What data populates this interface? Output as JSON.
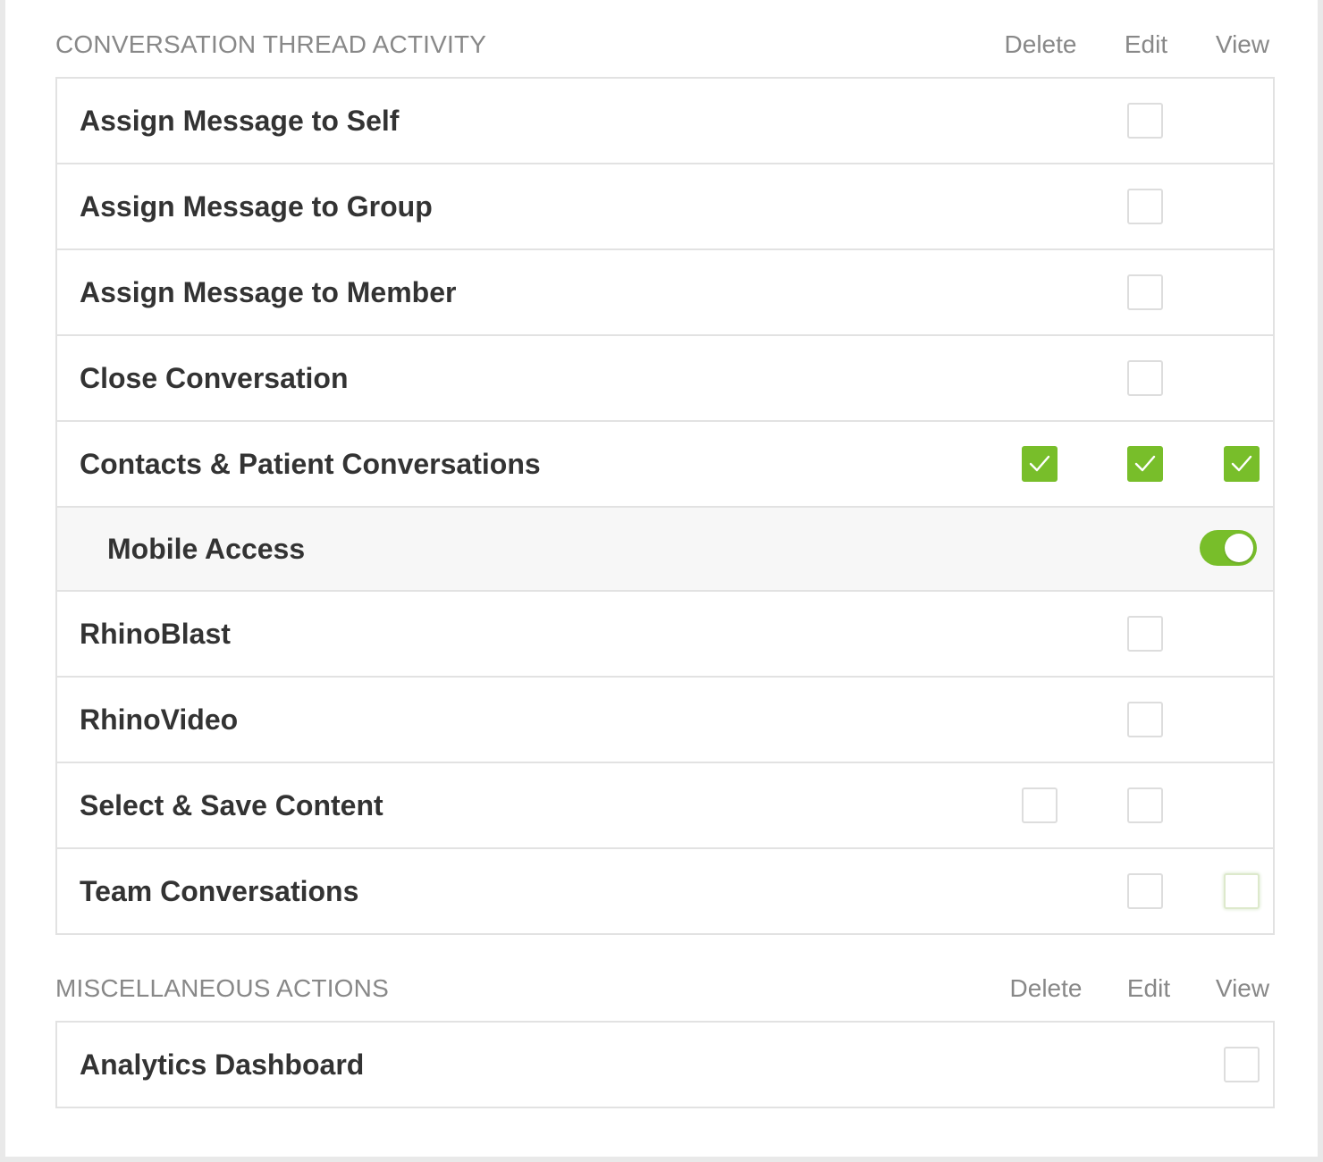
{
  "sections": [
    {
      "title": "CONVERSATION THREAD ACTIVITY",
      "columns": {
        "delete": "Delete",
        "edit": "Edit",
        "view": "View"
      },
      "rows": [
        {
          "label": "Assign Message to Self",
          "edit": false
        },
        {
          "label": "Assign Message to Group",
          "edit": false
        },
        {
          "label": "Assign Message to Member",
          "edit": false
        },
        {
          "label": "Close Conversation",
          "edit": false
        },
        {
          "label": "Contacts & Patient Conversations",
          "delete": true,
          "edit": true,
          "view": true
        },
        {
          "label": "Mobile Access",
          "toggle": true,
          "sub": true
        },
        {
          "label": "RhinoBlast",
          "edit": false
        },
        {
          "label": "RhinoVideo",
          "edit": false
        },
        {
          "label": "Select & Save Content",
          "delete": false,
          "edit": false
        },
        {
          "label": "Team Conversations",
          "edit": false,
          "view": false
        }
      ]
    },
    {
      "title": "MISCELLANEOUS ACTIONS",
      "columns": {
        "delete": "Delete",
        "edit": "Edit",
        "view": "View"
      },
      "rows": [
        {
          "label": "Analytics Dashboard",
          "view": false
        }
      ]
    }
  ],
  "colors": {
    "accent": "#78be2a",
    "border": "#e2e2e2",
    "muted_text": "#888888",
    "text": "#333333"
  }
}
